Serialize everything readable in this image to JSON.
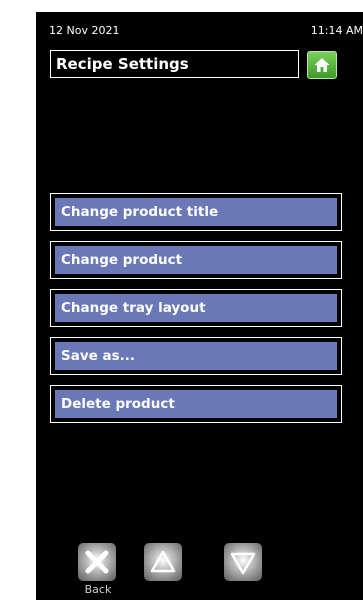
{
  "status": {
    "date": "12 Nov 2021",
    "time": "11:14 AM"
  },
  "header": {
    "title": "Recipe Settings",
    "home_icon": "home-icon"
  },
  "menu": {
    "items": [
      {
        "label": "Change product title"
      },
      {
        "label": "Change product"
      },
      {
        "label": "Change tray layout"
      },
      {
        "label": "Save as..."
      },
      {
        "label": "Delete product"
      }
    ]
  },
  "footer": {
    "back_label": "Back",
    "icons": [
      "close-icon",
      "up-arrow-icon",
      "down-arrow-icon"
    ]
  },
  "colors": {
    "background": "#000000",
    "menu_item_fill": "#6b78b8",
    "home_button": "#4caf3a"
  }
}
